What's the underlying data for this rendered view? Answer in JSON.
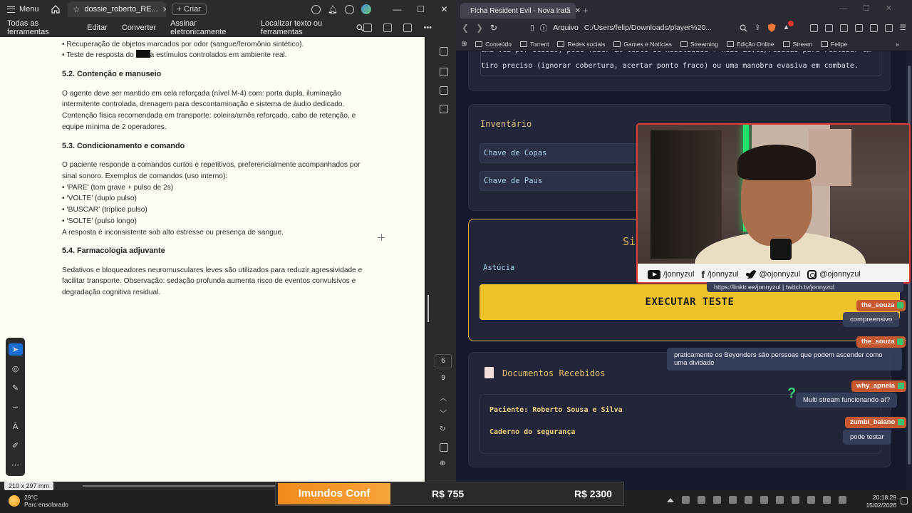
{
  "pdf": {
    "menu_label": "Menu",
    "tab_title": "dossie_roberto_RE...",
    "create_label": "Criar",
    "toolbar": {
      "all_tools": "Todas as ferramentas",
      "edit": "Editar",
      "convert": "Converter",
      "sign": "Assinar eletronicamente",
      "search": "Localizar texto ou ferramentas"
    },
    "lines": {
      "l1": "• Recuperação de objetos marcados por odor (sangue/feromônio sintético).",
      "l2a": "• Teste de resposta do ",
      "l2b": "a estímulos controlados em ambiente real.",
      "h52": "5.2. Contenção e manuseio",
      "p52a": "O agente deve ser mantido em cela reforçada (nível M-4) com: porta dupla, iluminação",
      "p52b": "intermitente controlada, drenagem para descontaminação e sistema de áudio dedicado.",
      "p52c": "Contenção física recomendada em transporte: coleira/arnês reforçado, cabo de retenção, e",
      "p52d": "equipe mínima de 2 operadores.",
      "h53": "5.3. Condicionamento e comando",
      "p53a": "O paciente responde a comandos curtos e repetitivos, preferencialmente acompanhados por",
      "p53b": "sinal sonoro. Exemplos de comandos (uso interno):",
      "c1": "• ‘PARE’ (tom grave + pulso de 2s)",
      "c2": "• ‘VOLTE’ (duplo pulso)",
      "c3": "• ‘BUSCAR’ (tríplice pulso)",
      "c4": "• ‘SOLTE’ (pulso longo)",
      "p53c": "A resposta é inconsistente sob alto estresse ou presença de sangue.",
      "h54": "5.4. Farmacologia adjuvante",
      "p54a": "Sedativos e bloqueadores neuromusculares leves são utilizados para reduzir agressividade e",
      "p54b": "facilitar transporte. Observação: sedação profunda aumenta risco de eventos convulsivos e",
      "p54c": "degradação cognitiva residual."
    },
    "page_current": "6",
    "page_total": "9",
    "page_size": "210 x 297 mm"
  },
  "browser": {
    "tab_title": "Ficha Resident Evil - Nova Iratã",
    "url_scheme": "Arquivo",
    "url_path": "C:/Users/felip/Downloads/player%20...",
    "bookmarks": [
      "Conteúdo",
      "Torrent",
      "Redes sociais",
      "Games e Notícias",
      "Streaming",
      "Edição Online",
      "Stream",
      "Felipe"
    ],
    "top_text_1": "uma vez por sessão, pode fazer um teste de Habilidade + Ruas Leves/Pesadas para realizar um",
    "top_text_2": "tiro preciso (ignorar cobertura, acertar ponto fraco) ou uma manobra evasiva em combate.",
    "inventory_title": "Inventário",
    "inventory_items": [
      "Chave de Copas",
      "Chave de Paus"
    ],
    "test_title_partial": "Si",
    "test_attr": "Astúcia",
    "execute_label": "EXECUTAR TESTE",
    "docs_title": "Documentos Recebidos",
    "docs": [
      "Paciente: Roberto Sousa e Silva",
      "Caderno do segurança"
    ]
  },
  "overlay": {
    "socials": [
      "/jonnyzul",
      "/jonnyzul",
      "@ojonnyzul",
      "@ojonnyzul"
    ],
    "url_strip": "https://linktr.ee/jonnyzul  |  twitch.tv/jonnyzul",
    "chat": [
      {
        "user": "the_souza",
        "msg": "compreensivo"
      },
      {
        "user": "the_souza",
        "msg": "praticamente os Beyonders são perssoas que podem ascender como uma dividade"
      },
      {
        "user": "why_apneia",
        "msg": "Multi stream funcionando aí?"
      },
      {
        "user": "zumbi_baiano",
        "msg": "pode testar"
      }
    ],
    "ticker_label": "Imundos Conf",
    "ticker_val1": "R$ 755",
    "ticker_val2": "R$ 2300"
  },
  "taskbar": {
    "temp": "29°C",
    "weather": "Parc ensolarado",
    "time": "20:18:29",
    "date": "15/02/2026"
  },
  "colors": {
    "accent_yellow": "#f0c22a",
    "chat_name": "#c7582f",
    "webcam_border": "#e03a3a",
    "pdf_tool_selected": "#1a6fd6"
  }
}
